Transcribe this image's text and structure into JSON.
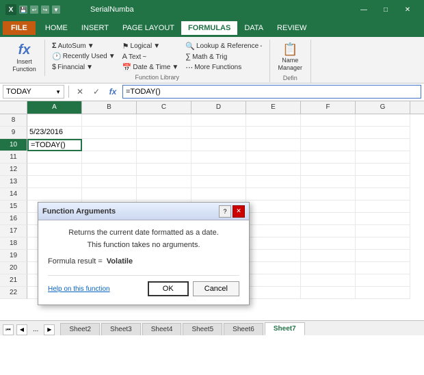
{
  "titlebar": {
    "app_title": "SerialNumba",
    "icon": "X",
    "undo": "↩",
    "redo": "↪",
    "save": "💾",
    "win_min": "—",
    "win_max": "□",
    "win_close": "✕"
  },
  "menu": {
    "file": "FILE",
    "items": [
      "HOME",
      "INSERT",
      "PAGE LAYOUT",
      "FORMULAS",
      "DATA",
      "REVIEW"
    ]
  },
  "ribbon": {
    "insert_function": {
      "label": "Insert\nFunction",
      "icon": "fx"
    },
    "autosum": {
      "label": "AutoSum",
      "arrow": "▼"
    },
    "recently_used": {
      "label": "Recently Used",
      "arrow": "▼"
    },
    "financial": {
      "label": "Financial",
      "arrow": "▼"
    },
    "logical": {
      "label": "Logical",
      "arrow": "▼"
    },
    "text": {
      "label": "Text",
      "arrow": "~"
    },
    "date_time": {
      "label": "Date & Time",
      "arrow": "▼"
    },
    "lookup_ref": {
      "label": "Lookup & Reference",
      "arrow": "-"
    },
    "math_trig": {
      "label": "Math & Trig"
    },
    "more_functions": {
      "label": "More Functions"
    },
    "function_library_label": "Function Library",
    "name_manager": {
      "label": "Name\nManager"
    },
    "define_label": "Defin"
  },
  "formula_bar": {
    "name_box": "TODAY",
    "cancel": "✕",
    "confirm": "✓",
    "fx": "fx",
    "formula": "=TODAY()"
  },
  "columns": [
    "A",
    "B",
    "C",
    "D",
    "E",
    "F",
    "G"
  ],
  "rows": [
    {
      "num": 8,
      "cells": [
        "",
        "",
        "",
        "",
        "",
        "",
        ""
      ]
    },
    {
      "num": 9,
      "cells": [
        "5/23/2016",
        "",
        "",
        "",
        "",
        "",
        ""
      ]
    },
    {
      "num": 10,
      "cells": [
        "=TODAY()",
        "",
        "",
        "",
        "",
        "",
        ""
      ],
      "active": true
    },
    {
      "num": 11,
      "cells": [
        "",
        "",
        "",
        "",
        "",
        "",
        ""
      ]
    },
    {
      "num": 12,
      "cells": [
        "",
        "",
        "",
        "",
        "",
        "",
        ""
      ]
    },
    {
      "num": 13,
      "cells": [
        "",
        "",
        "",
        "",
        "",
        "",
        ""
      ]
    },
    {
      "num": 14,
      "cells": [
        "",
        "",
        "",
        "",
        "",
        "",
        ""
      ]
    },
    {
      "num": 15,
      "cells": [
        "",
        "",
        "",
        "",
        "",
        "",
        ""
      ]
    },
    {
      "num": 16,
      "cells": [
        "",
        "",
        "",
        "",
        "",
        "",
        ""
      ]
    },
    {
      "num": 17,
      "cells": [
        "",
        "",
        "",
        "",
        "",
        "",
        ""
      ]
    },
    {
      "num": 18,
      "cells": [
        "",
        "",
        "",
        "",
        "",
        "",
        ""
      ]
    },
    {
      "num": 19,
      "cells": [
        "",
        "",
        "",
        "",
        "",
        "",
        ""
      ]
    },
    {
      "num": 20,
      "cells": [
        "",
        "",
        "",
        "",
        "",
        "",
        ""
      ]
    },
    {
      "num": 21,
      "cells": [
        "",
        "",
        "",
        "",
        "",
        "",
        ""
      ]
    },
    {
      "num": 22,
      "cells": [
        "",
        "",
        "",
        "",
        "",
        "",
        ""
      ]
    }
  ],
  "dialog": {
    "title": "Function Arguments",
    "description": "Returns the current date formatted as a date.",
    "subdescription": "This function takes no arguments.",
    "formula_result_label": "Formula result =",
    "formula_result_value": "Volatile",
    "help_link": "Help on this function",
    "ok_label": "OK",
    "cancel_label": "Cancel"
  },
  "sheets": {
    "tabs": [
      "Sheet2",
      "Sheet3",
      "Sheet4",
      "Sheet5",
      "Sheet6",
      "Sheet7"
    ],
    "active": "Sheet7",
    "ellipsis": "..."
  }
}
